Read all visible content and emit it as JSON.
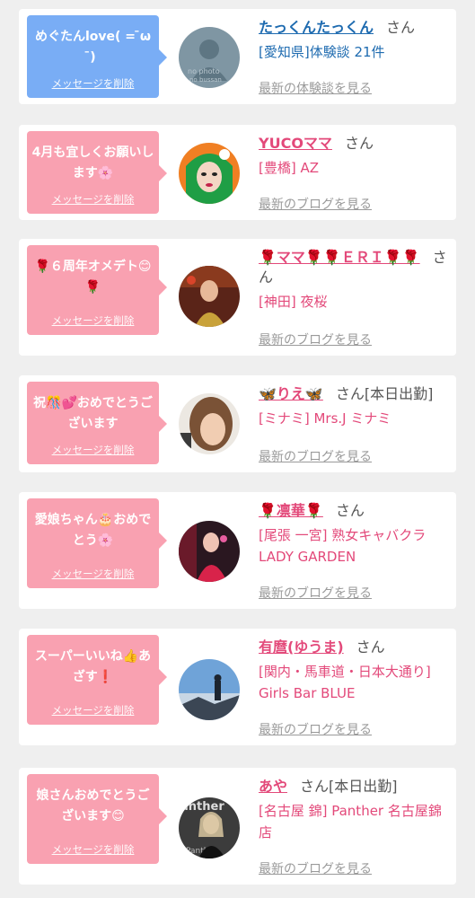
{
  "delete_label": "メッセージを削除",
  "san": "さん",
  "cards": [
    {
      "message": "めぐたんlove( = ̄ω ̄)",
      "name": "たっくんたっくん",
      "status": "",
      "shop": "[愛知県]体験談 21件",
      "link": "最新の体験談を見る",
      "theme": "blue",
      "avatar_icon": "no-photo-avatar",
      "avatar_text_1": "no photo",
      "avatar_text_2": "no bussan"
    },
    {
      "message": "4月も宜しくお願いします🌸",
      "name": "YUCOママ",
      "status": "",
      "shop": "[豊橋] AZ",
      "link": "最新のブログを見る",
      "theme": "pink",
      "avatar_icon": "green-hair-avatar"
    },
    {
      "message": "🌹６周年オメデト😊🌹",
      "name": "🌹ママ🌹🌹ＥＲＩ🌹🌹",
      "status": "",
      "shop": "[神田] 夜桜",
      "link": "最新のブログを見る",
      "theme": "pink",
      "avatar_icon": "woman-avatar"
    },
    {
      "message": "祝🎊💕おめでとうございます",
      "name": "🦋りえ🦋",
      "status": "[本日出勤]",
      "shop": "[ミナミ] Mrs.J ミナミ",
      "link": "最新のブログを見る",
      "theme": "pink",
      "avatar_icon": "selfie-avatar"
    },
    {
      "message": "愛娘ちゃん🎂おめでとう🌸",
      "name": "🌹凛華🌹",
      "status": "",
      "shop": "[尾張 一宮] 熟女キャバクラ LADY GARDEN",
      "link": "最新のブログを見る",
      "theme": "pink",
      "avatar_icon": "red-dress-avatar"
    },
    {
      "message": "スーパーいいね👍あざす❗",
      "name": "有麿(ゆうま)",
      "status": "",
      "shop": "[関内・馬車道・日本大通り] Girls Bar BLUE",
      "link": "最新のブログを見る",
      "theme": "pink",
      "avatar_icon": "landscape-avatar"
    },
    {
      "message": "娘さんおめでとうございます😊",
      "name": "あや",
      "status": "[本日出勤]",
      "shop": "[名古屋 錦] Panther 名古屋錦店",
      "link": "最新のブログを見る",
      "theme": "pink",
      "avatar_icon": "panther-avatar",
      "avatar_text_1": "anther",
      "avatar_text_2": "Panther"
    }
  ]
}
